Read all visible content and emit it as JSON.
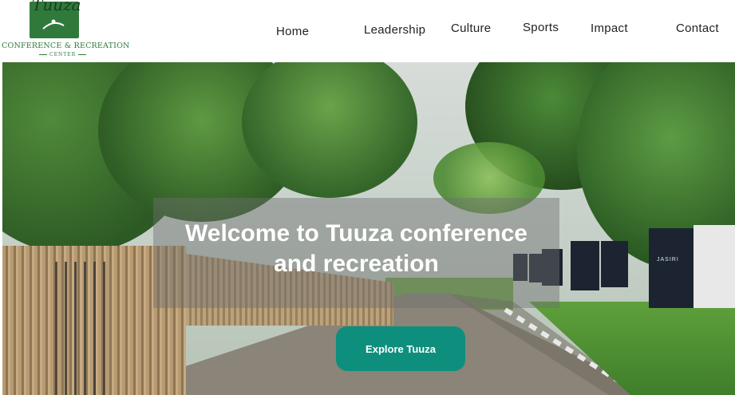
{
  "brand": {
    "script_text": "Tuuza",
    "name": "CONFERENCE & RECREATION",
    "sub": "CENTER",
    "color": "#2f7a3b"
  },
  "nav": [
    {
      "label": "Home"
    },
    {
      "label": "Leadership"
    },
    {
      "label": "Culture"
    },
    {
      "label": "Sports"
    },
    {
      "label": "Impact"
    },
    {
      "label": "Contact"
    }
  ],
  "hero": {
    "title_line1": "Welcome to Tuuza conference",
    "title_line2": "and recreation",
    "cta_label": "Explore Tuuza",
    "cta_color": "#0e8f7e",
    "banner_text": "JASIRI"
  }
}
